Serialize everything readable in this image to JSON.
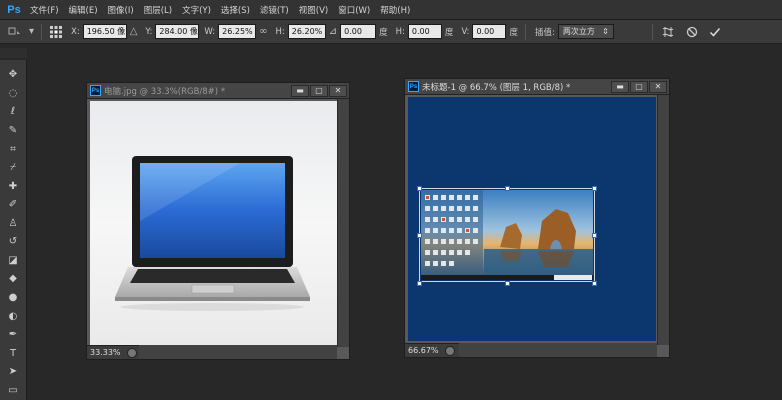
{
  "app": {
    "logo": "Ps"
  },
  "menu": [
    "文件(F)",
    "编辑(E)",
    "图像(I)",
    "图层(L)",
    "文字(Y)",
    "选择(S)",
    "滤镜(T)",
    "视图(V)",
    "窗口(W)",
    "帮助(H)"
  ],
  "options": {
    "x_label": "X:",
    "x_value": "196.50 像",
    "y_label": "Y:",
    "y_value": "284.00 像",
    "w_label": "W:",
    "w_value": "26.25%",
    "link_icon": "∞",
    "h_label": "H:",
    "h_value": "26.20%",
    "angle_value": "0.00",
    "angle_unit": "度",
    "hskew_label": "H:",
    "hskew_value": "0.00",
    "hskew_unit": "度",
    "vskew_label": "V:",
    "vskew_value": "0.00",
    "vskew_unit": "度",
    "interp_label": "插值:",
    "interp_value": "两次立方"
  },
  "doc1": {
    "title": "电脑.jpg @ 33.3%(RGB/8#) *",
    "zoom": "33.33%"
  },
  "doc2": {
    "title": "未标题-1 @ 66.7% (图层 1, RGB/8) *",
    "zoom": "66.67%"
  },
  "colors": {
    "doc2_bg": "#0c366e",
    "accent": "#31a8ff"
  }
}
